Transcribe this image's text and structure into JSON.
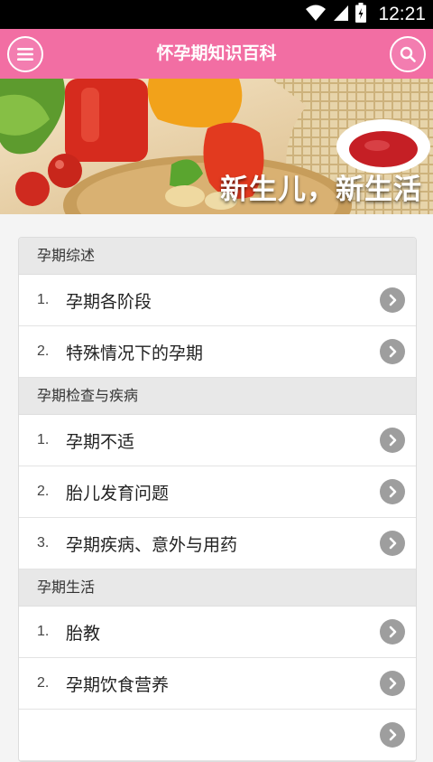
{
  "status_bar": {
    "time": "12:21",
    "icons": [
      "wifi-icon",
      "signal-icon",
      "battery-icon"
    ]
  },
  "app_bar": {
    "title": "怀孕期知识百科",
    "left_icon": "menu-icon",
    "right_icon": "search-icon",
    "color": "#f26ea3"
  },
  "banner": {
    "caption": "新生儿，新生活"
  },
  "sections": [
    {
      "title": "孕期综述",
      "items": [
        {
          "num": "1.",
          "label": "孕期各阶段"
        },
        {
          "num": "2.",
          "label": "特殊情况下的孕期"
        }
      ]
    },
    {
      "title": "孕期检查与疾病",
      "items": [
        {
          "num": "1.",
          "label": "孕期不适"
        },
        {
          "num": "2.",
          "label": "胎儿发育问题"
        },
        {
          "num": "3.",
          "label": "孕期疾病、意外与用药"
        }
      ]
    },
    {
      "title": "孕期生活",
      "items": [
        {
          "num": "1.",
          "label": "胎教"
        },
        {
          "num": "2.",
          "label": "孕期饮食营养"
        },
        {
          "num": "",
          "label": ""
        }
      ]
    }
  ]
}
